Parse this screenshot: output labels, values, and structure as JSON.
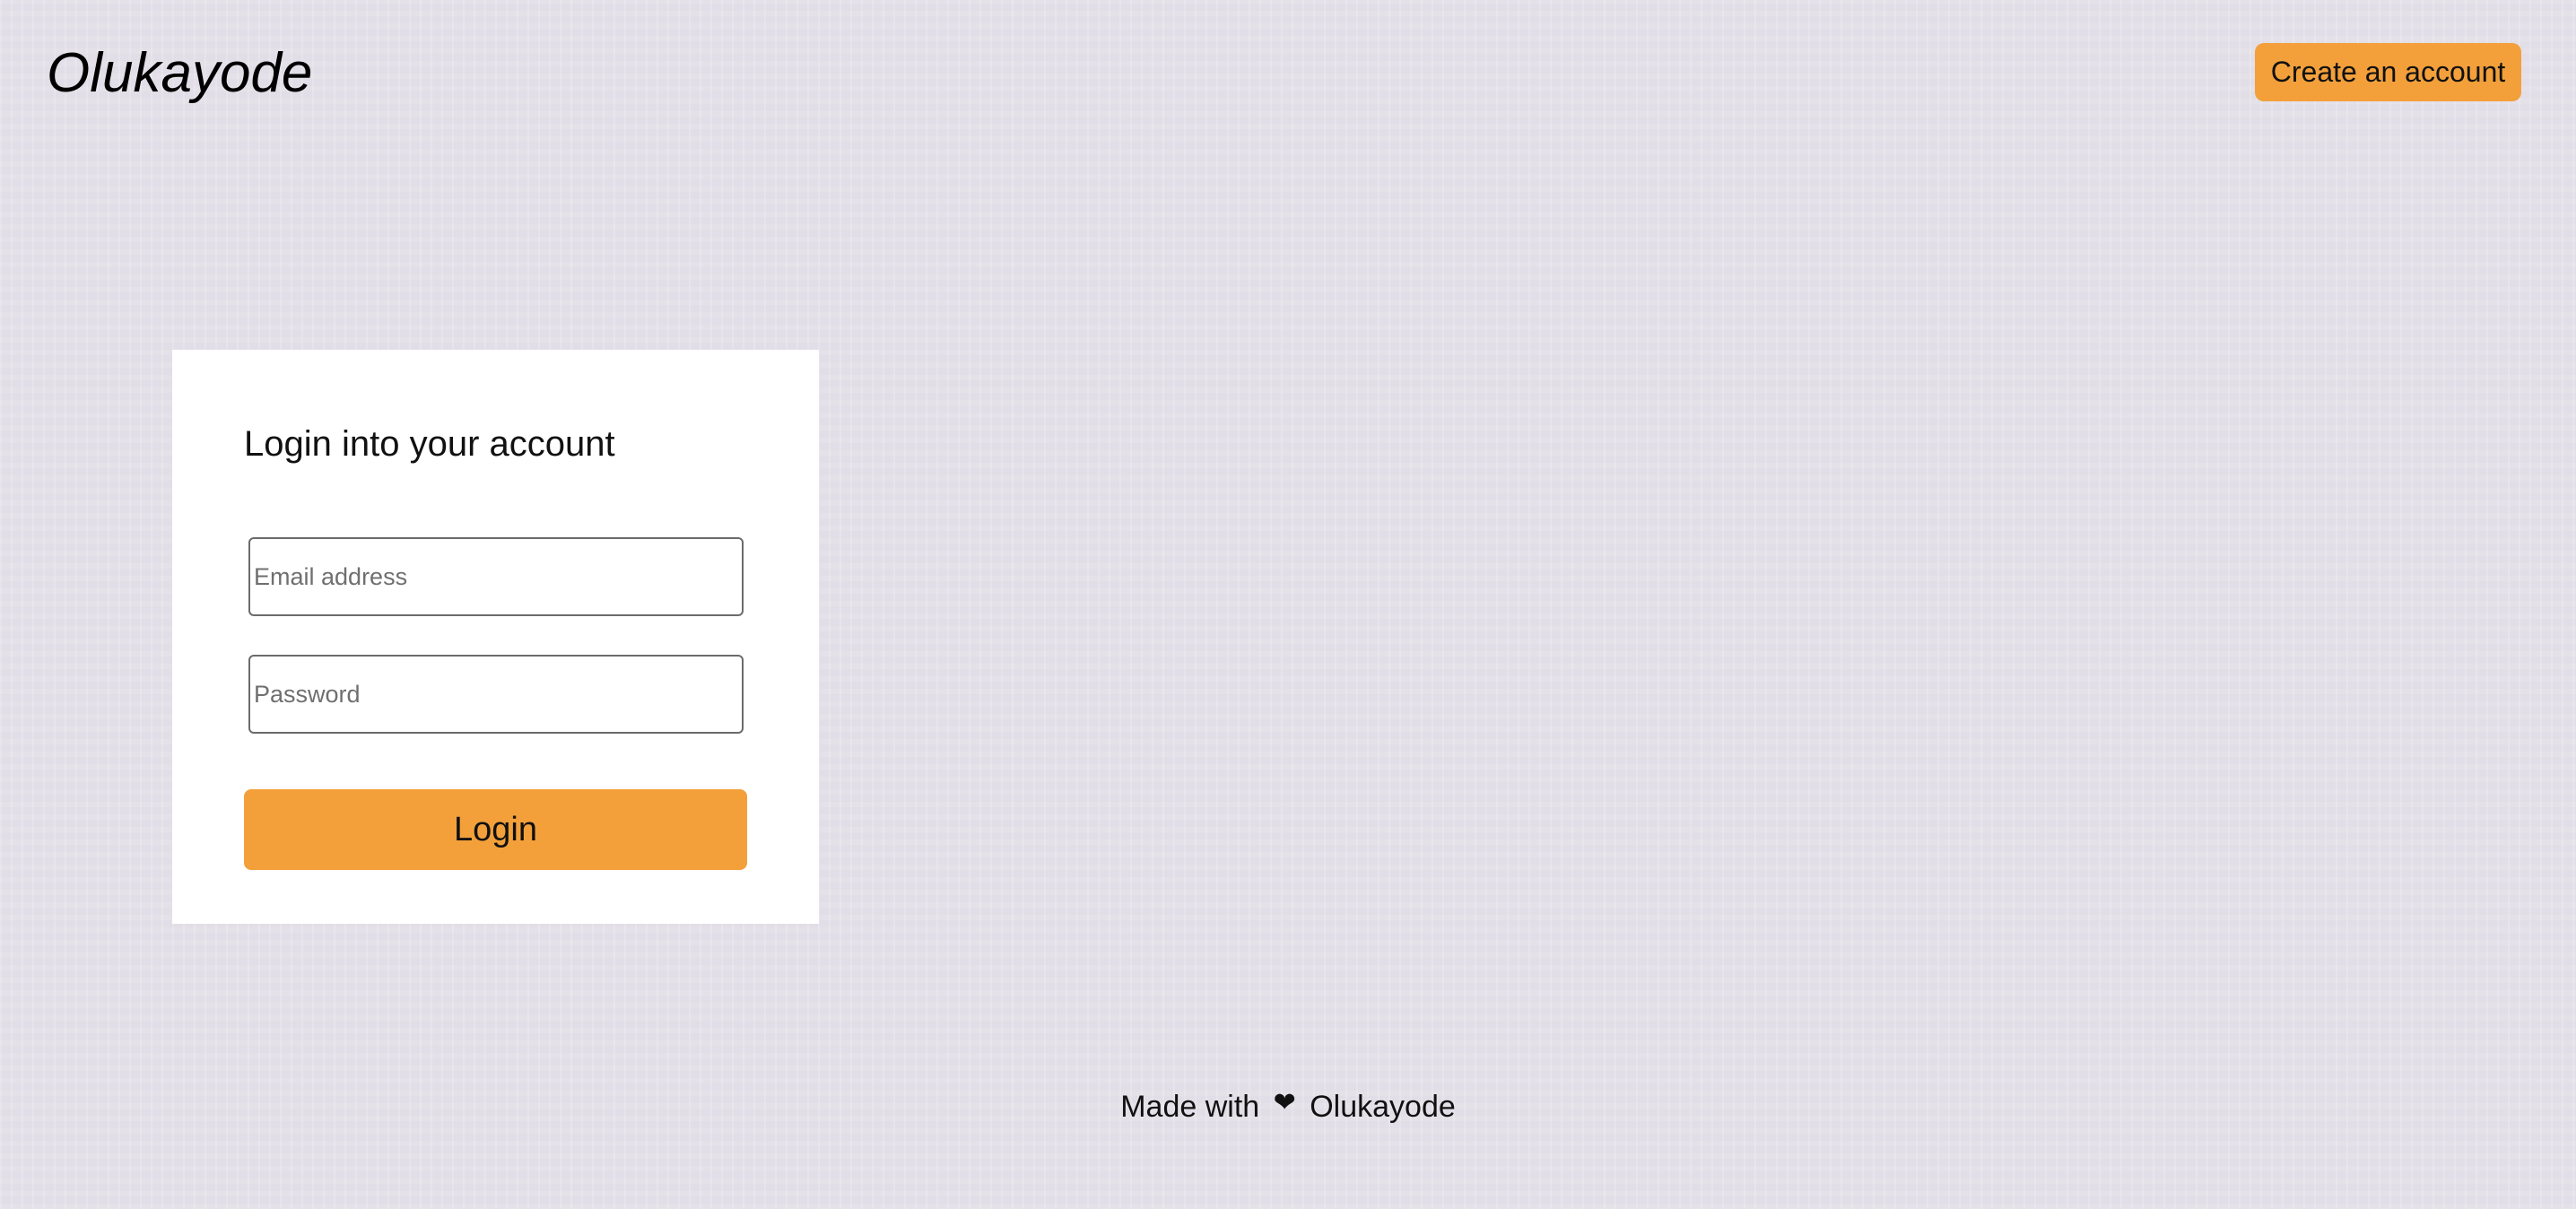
{
  "header": {
    "brand": "Olukayode",
    "create_account_label": "Create an account"
  },
  "login": {
    "title": "Login into your account",
    "email_placeholder": "Email address",
    "email_value": "",
    "password_placeholder": "Password",
    "password_value": "",
    "submit_label": "Login"
  },
  "footer": {
    "made_with": "Made with",
    "heart_icon": "heart-icon",
    "author": "Olukayode"
  },
  "colors": {
    "accent": "#f3a03b",
    "background": "#e1dee7",
    "card": "#ffffff"
  }
}
